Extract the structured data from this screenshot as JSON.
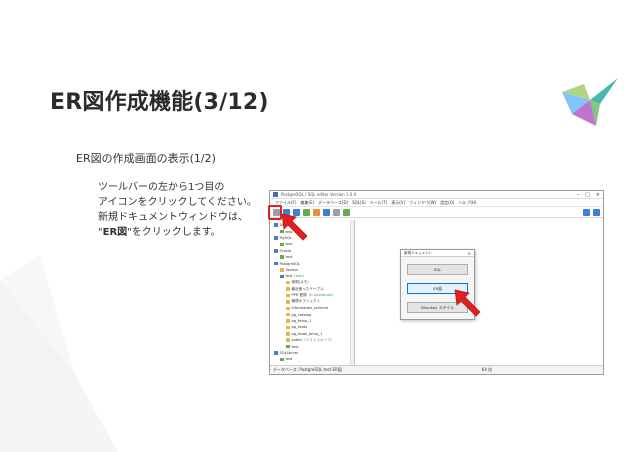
{
  "slide": {
    "title": "ER図作成機能(3/12)",
    "subtitle": "ER図の作成画面の表示(1/2)",
    "desc_line1": "ツールバーの左から1つ目の",
    "desc_line2": "アイコンをクリックしてください。",
    "desc_line3": "新規ドキュメントウィンドウは、",
    "desc_line4_prefix": "\"",
    "desc_line4_bold": "ER図",
    "desc_line4_suffix": "\"をクリックします。"
  },
  "app": {
    "window_title": "PostgreSQL / SQL editor Version 1.0.0",
    "menu": [
      "ファイル(F)",
      "編集(E)",
      "データベース(D)",
      "SQL(S)",
      "ツール(T)",
      "表示(V)",
      "ウィンドウ(W)",
      "設定(O)",
      "ヘルプ(H)"
    ],
    "tree": [
      {
        "label": "DB2",
        "icon": "db-icon",
        "indent": 0
      },
      {
        "label": "test",
        "icon": "table-icon",
        "indent": 1
      },
      {
        "label": "MySQL",
        "icon": "db-icon",
        "indent": 0
      },
      {
        "label": "test",
        "icon": "table-icon",
        "indent": 1
      },
      {
        "label": "Oracle",
        "icon": "db-icon",
        "indent": 0
      },
      {
        "label": "test",
        "icon": "table-icon",
        "indent": 1
      },
      {
        "label": "PostgreSQL",
        "icon": "db-icon",
        "indent": 0
      },
      {
        "label": "Vendor",
        "icon": "folder-icon",
        "indent": 1
      },
      {
        "label": "test",
        "icon": "db-icon",
        "indent": 1,
        "note": "(test)"
      },
      {
        "label": "参照(メモ)",
        "icon": "folder-icon",
        "indent": 2
      },
      {
        "label": "最近使ったテーブル",
        "icon": "folder-icon",
        "indent": 2
      },
      {
        "label": "PPR 登録",
        "icon": "folder-icon",
        "indent": 2,
        "note": "(tl-ppsqlsutw)"
      },
      {
        "label": "管理オブジェクト",
        "icon": "folder-icon",
        "indent": 2
      },
      {
        "label": "information_schema",
        "icon": "folder-icon",
        "indent": 2
      },
      {
        "label": "pg_catalog",
        "icon": "folder-icon",
        "indent": 2
      },
      {
        "label": "pg_temp_1",
        "icon": "folder-icon",
        "indent": 2
      },
      {
        "label": "pg_toast",
        "icon": "folder-icon",
        "indent": 2
      },
      {
        "label": "pg_toast_temp_1",
        "icon": "folder-icon",
        "indent": 2
      },
      {
        "label": "public",
        "icon": "folder-icon",
        "indent": 2,
        "note": "(テストスキーマ)"
      },
      {
        "label": "test",
        "icon": "table-icon",
        "indent": 2
      },
      {
        "label": "SQLServer",
        "icon": "db-icon",
        "indent": 0
      },
      {
        "label": "test",
        "icon": "table-icon",
        "indent": 1
      }
    ],
    "dialog": {
      "title": "新規ドキュメント",
      "close": "×",
      "buttons": [
        "SQL",
        "ER図",
        "Bitsukey スタイル"
      ],
      "active_index": 1
    },
    "statusbar": {
      "left": "データベース: PostgreSQL  test  ER図",
      "zoom": "64 倍"
    },
    "colors": {
      "highlight": "#e02020",
      "arrow": "#e02020",
      "focus": "#0078d7"
    }
  }
}
